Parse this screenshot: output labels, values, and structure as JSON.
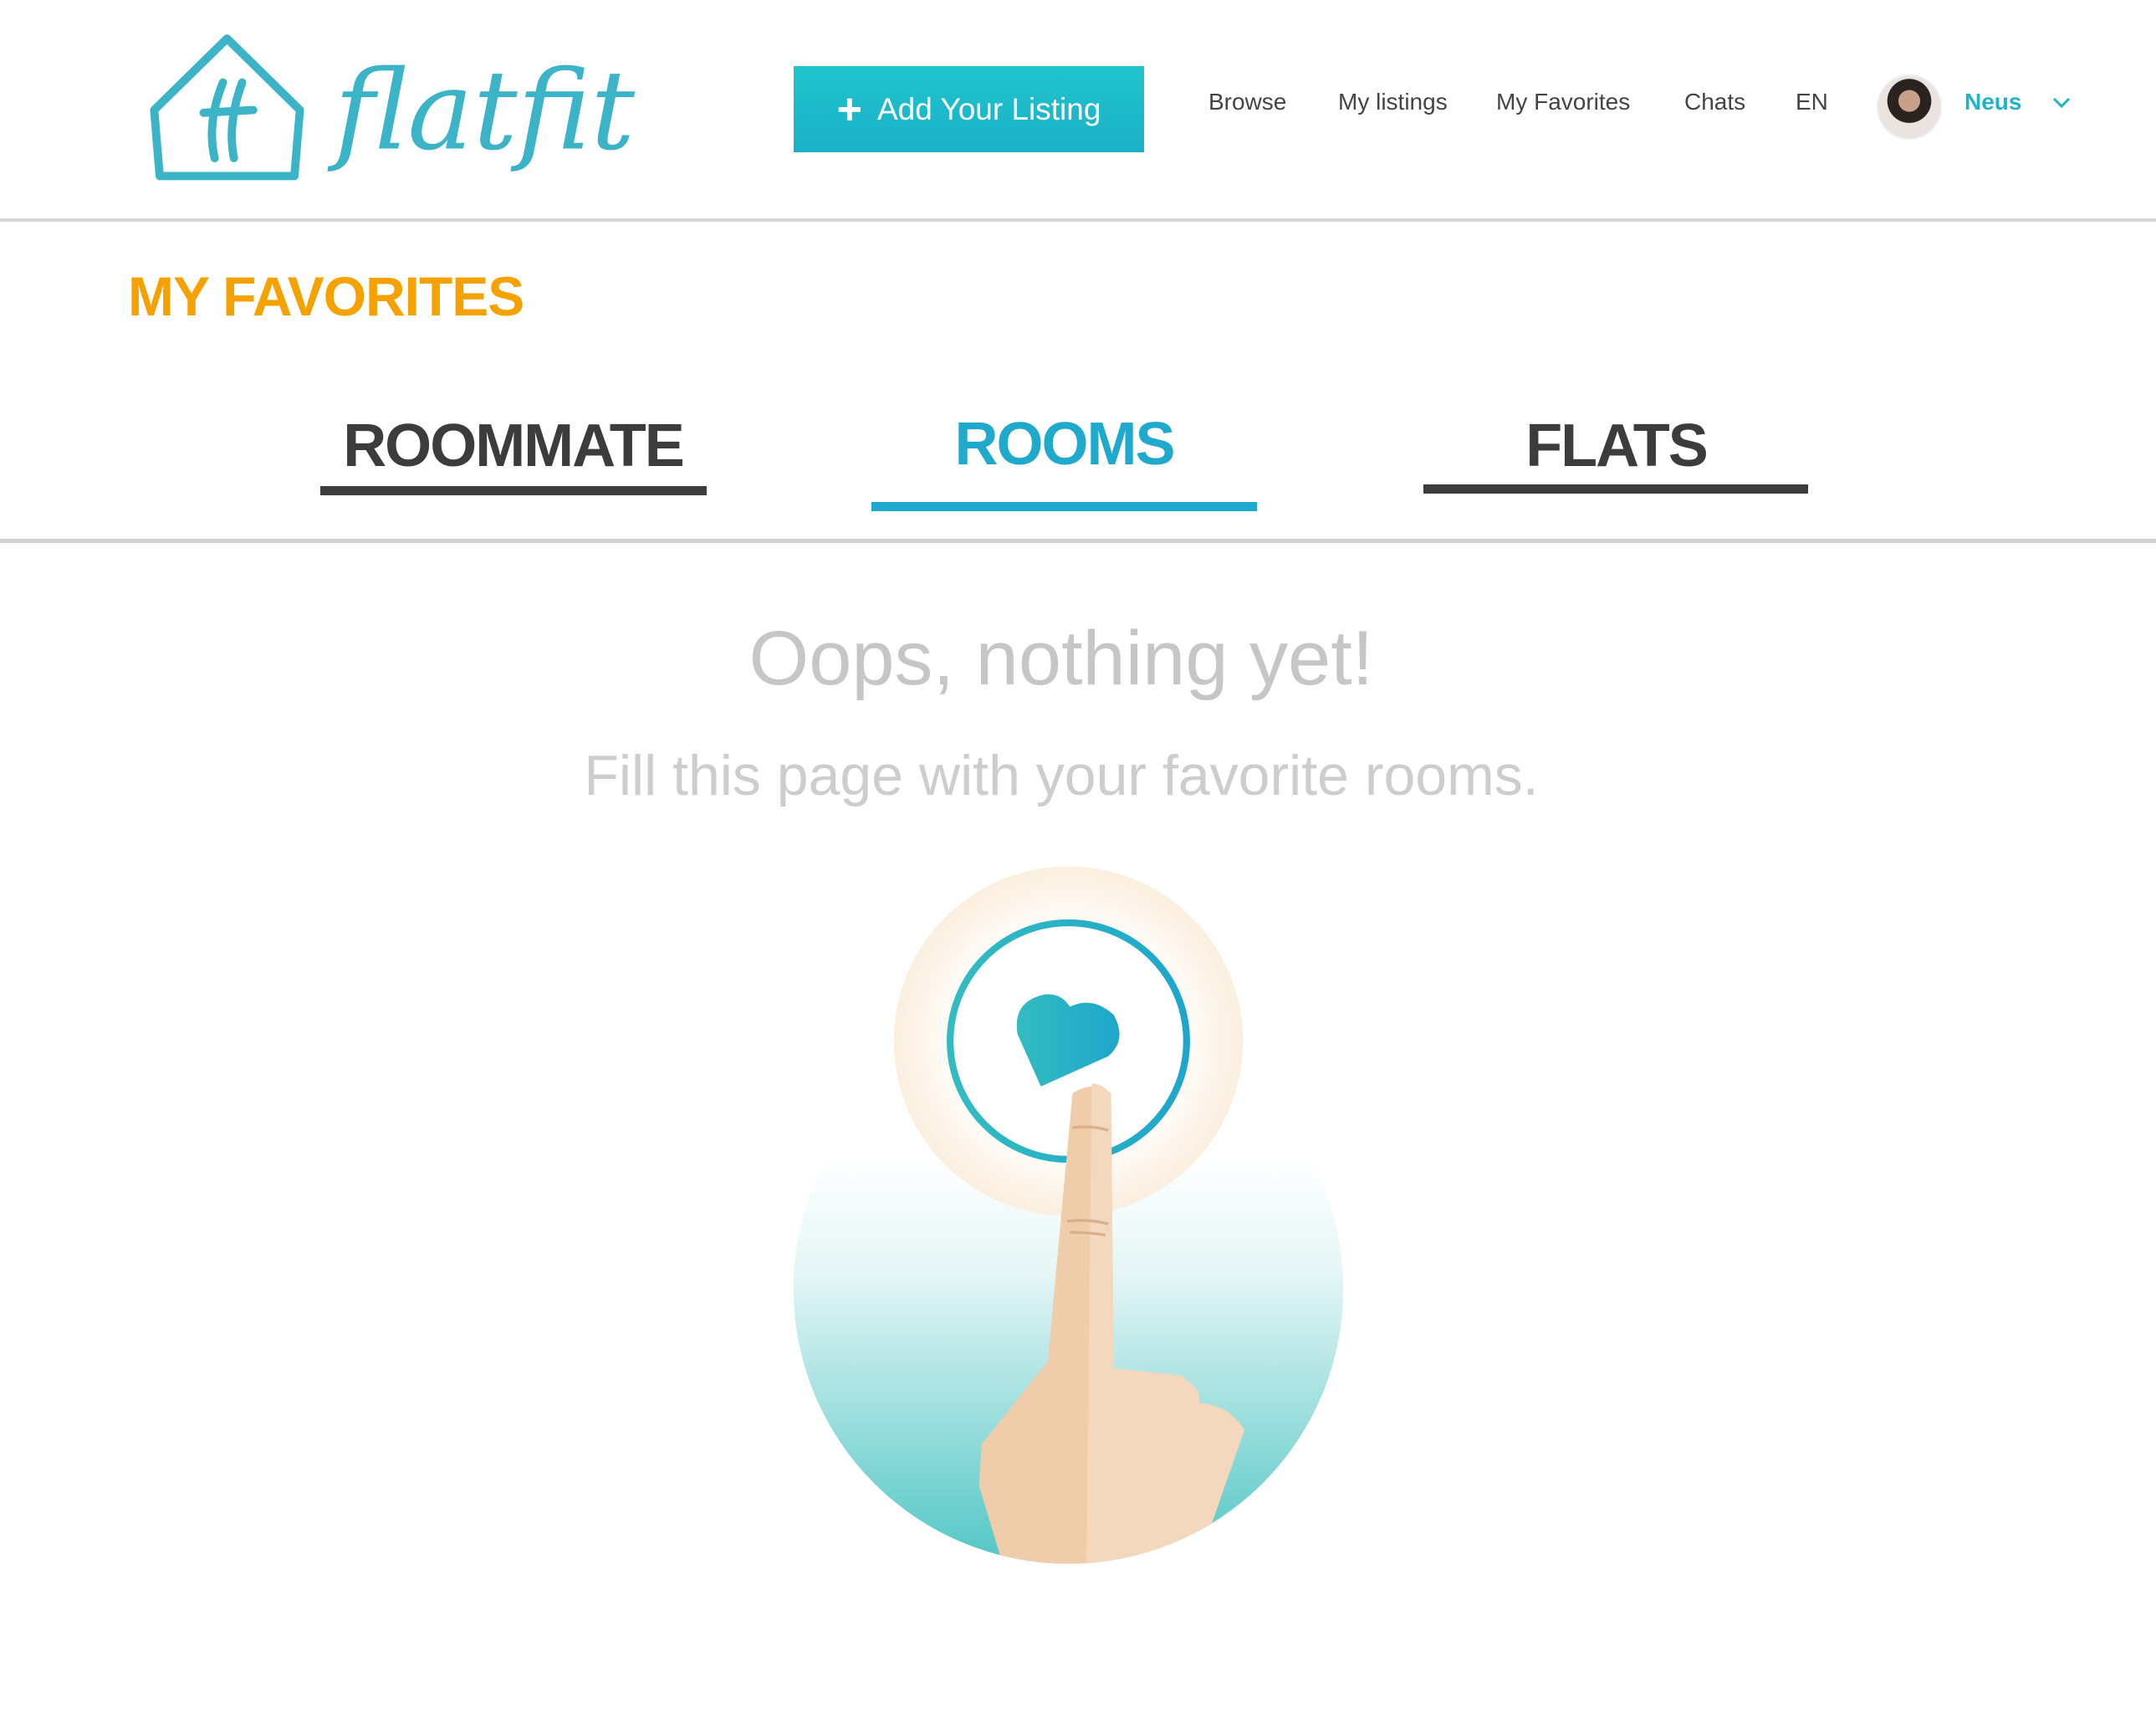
{
  "header": {
    "logo_text": "flatfit",
    "add_listing_label": "Add Your Listing",
    "nav": [
      "Browse",
      "My listings",
      "My Favorites",
      "Chats",
      "EN"
    ],
    "user_name": "Neus"
  },
  "page": {
    "title": "MY FAVORITES",
    "tabs": [
      {
        "label": "ROOMMATE",
        "active": false
      },
      {
        "label": "ROOMS",
        "active": true
      },
      {
        "label": "FLATS",
        "active": false
      }
    ],
    "empty_title": "Oops, nothing yet!",
    "empty_subtitle": "Fill this page with your favorite rooms."
  },
  "colors": {
    "accent": "#1fb4c9",
    "title": "#f5a100",
    "tab_inactive": "#3c3c3c"
  }
}
